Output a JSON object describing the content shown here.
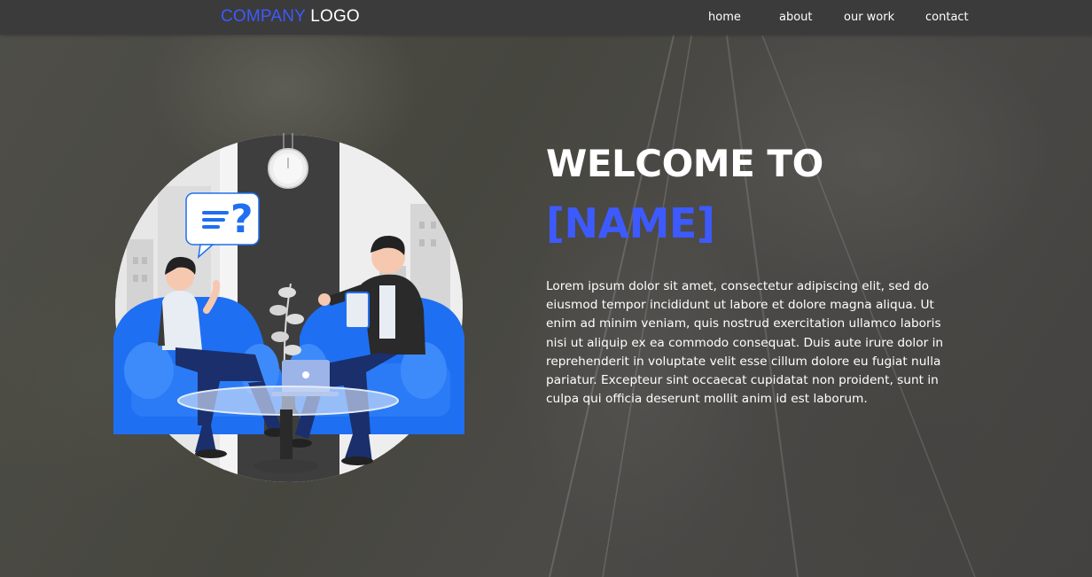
{
  "navbar": {
    "logo_company": "COMPANY",
    "logo_word": "LOGO",
    "links": [
      "home",
      "about",
      "our work",
      "contact"
    ]
  },
  "hero": {
    "welcome": "WELCOME TO",
    "name": "[NAME]",
    "paragraph": "Lorem ipsum dolor sit amet, consectetur adipiscing elit, sed do eiusmod tempor incididunt ut labore et dolore magna aliqua. Ut enim ad minim veniam, quis nostrud exercitation ullamco laboris nisi ut aliquip ex ea commodo consequat. Duis aute irure dolor in reprehenderit in voluptate velit esse cillum dolore eu fugiat nulla pariatur. Excepteur sint occaecat cupidatat non proident, sunt in culpa qui officia deserunt mollit anim id est laborum."
  },
  "colors": {
    "accent": "#3d5afe",
    "navbar": "#3b3b3b",
    "sofa": "#1f6ff2",
    "text": "#ffffff"
  },
  "illustration": {
    "icons": [
      "chat-question-icon",
      "wall-clock-icon",
      "plant-icon",
      "laptop-icon"
    ]
  }
}
